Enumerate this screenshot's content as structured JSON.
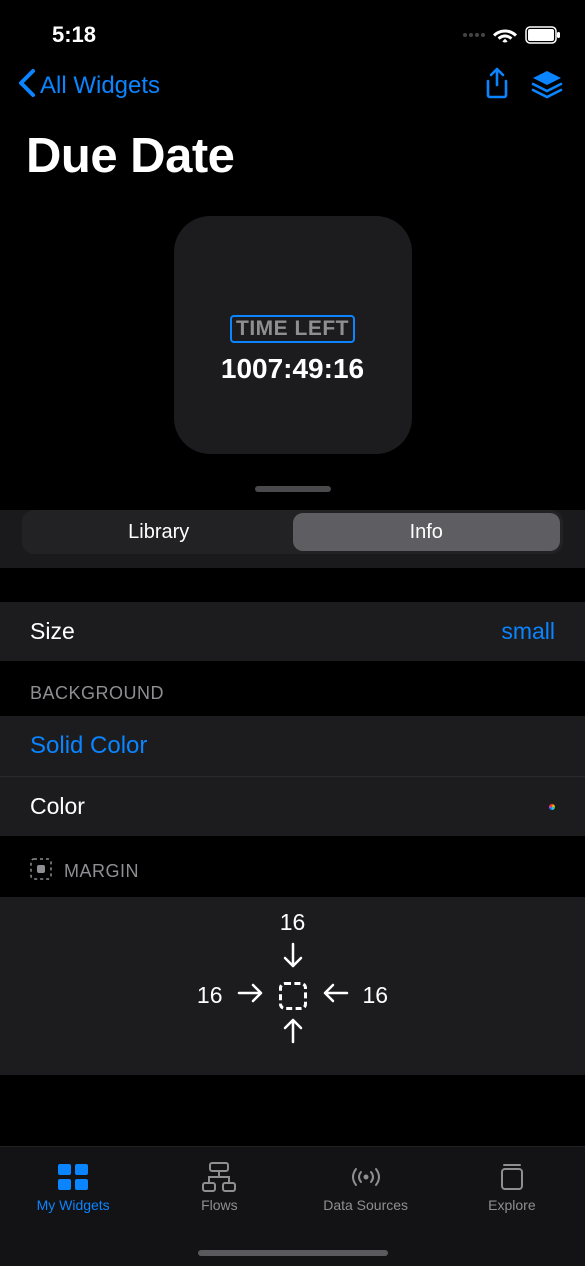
{
  "status": {
    "time": "5:18"
  },
  "nav": {
    "back_label": "All Widgets"
  },
  "title": "Due Date",
  "widget": {
    "label": "TIME LEFT",
    "value": "1007:49:16"
  },
  "tabs": {
    "library": "Library",
    "info": "Info"
  },
  "settings": {
    "size_label": "Size",
    "size_value": "small",
    "background_header": "BACKGROUND",
    "solid_color_label": "Solid Color",
    "color_label": "Color",
    "margin_header": "MARGIN",
    "margin": {
      "top": "16",
      "left": "16",
      "right": "16"
    }
  },
  "tabbar": {
    "my_widgets": "My Widgets",
    "flows": "Flows",
    "data_sources": "Data Sources",
    "explore": "Explore"
  }
}
